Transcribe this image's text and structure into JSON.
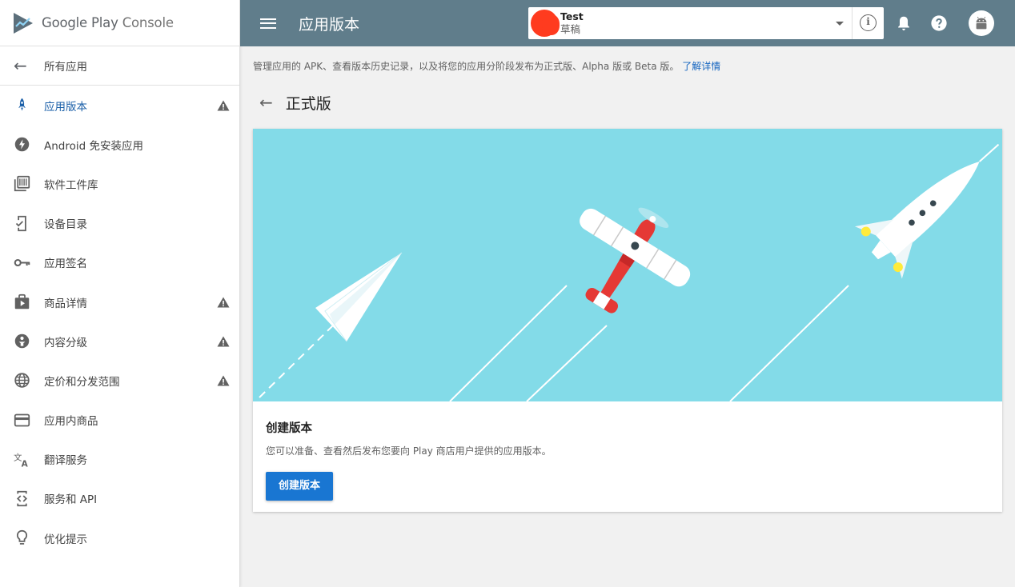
{
  "brand": {
    "google_play": "Google Play",
    "console": "Console"
  },
  "sidebar": {
    "back_label": "所有应用",
    "items": [
      {
        "label": "应用版本",
        "icon": "rocket-icon",
        "active": true,
        "warning": true
      },
      {
        "label": "Android 免安装应用",
        "icon": "bolt-icon",
        "warning": false
      },
      {
        "label": "软件工件库",
        "icon": "library-icon",
        "warning": false
      },
      {
        "label": "设备目录",
        "icon": "device-check-icon",
        "warning": false
      },
      {
        "label": "应用签名",
        "icon": "key-icon",
        "warning": false
      },
      {
        "label": "商品详情",
        "icon": "store-listing-icon",
        "warning": true
      },
      {
        "label": "内容分级",
        "icon": "content-rating-icon",
        "warning": true
      },
      {
        "label": "定价和分发范围",
        "icon": "globe-icon",
        "warning": true
      },
      {
        "label": "应用内商品",
        "icon": "credit-card-icon",
        "warning": false
      },
      {
        "label": "翻译服务",
        "icon": "translate-icon",
        "warning": false
      },
      {
        "label": "服务和 API",
        "icon": "api-icon",
        "warning": false
      },
      {
        "label": "优化提示",
        "icon": "lightbulb-icon",
        "warning": false
      }
    ]
  },
  "header": {
    "title": "应用版本",
    "app_name": "Test",
    "app_status": "草稿"
  },
  "main": {
    "description": "管理应用的 APK、查看版本历史记录，以及将您的应用分阶段发布为正式版、Alpha 版或 Beta 版。",
    "learn_more": "了解详情",
    "track_title": "正式版",
    "card": {
      "title": "创建版本",
      "text": "您可以准备、查看然后发布您要向 Play 商店用户提供的应用版本。",
      "button": "创建版本"
    }
  },
  "colors": {
    "topbar": "#607d8b",
    "accent": "#1976d2",
    "hero_bg": "#83dbe8",
    "active_nav": "#1a5fa8"
  }
}
